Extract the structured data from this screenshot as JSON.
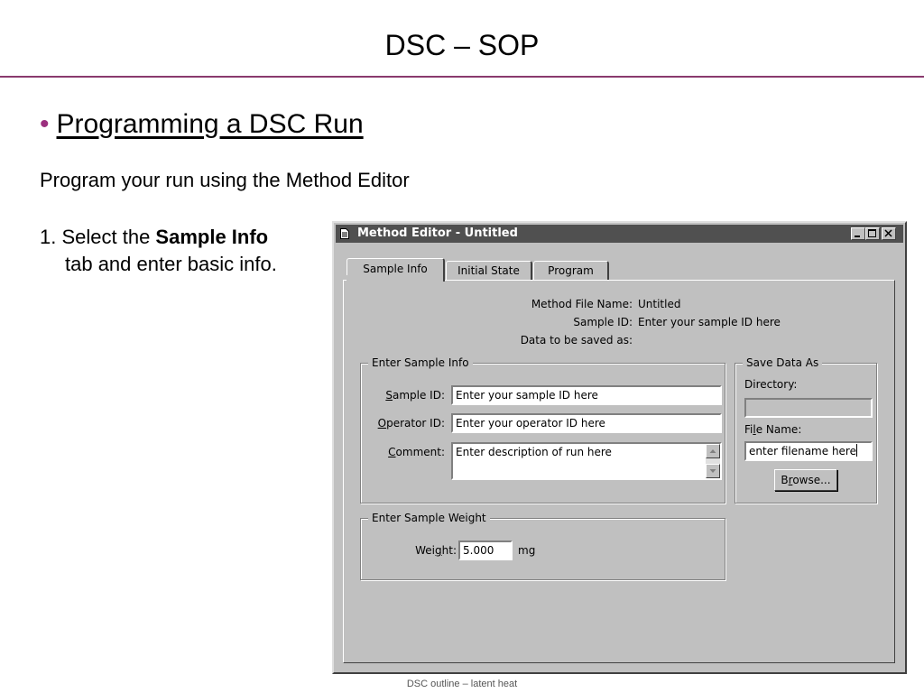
{
  "slide": {
    "title": "DSC – SOP",
    "heading_bullet": "•",
    "heading": "Programming a DSC Run",
    "intro": "Program your run using the Method Editor",
    "step_prefix": "1. Select the ",
    "step_bold": "Sample Info",
    "step_line2": "tab and enter basic info.",
    "footer": "DSC outline – latent heat",
    "colors": {
      "rule": "#8a3a6e",
      "bullet": "#9b2f7e"
    }
  },
  "window": {
    "title": "Method Editor - Untitled",
    "icon": "document-icon",
    "controls": [
      "minimize-icon",
      "maximize-icon",
      "close-icon"
    ],
    "tabs": [
      {
        "label": "Sample Info",
        "active": true
      },
      {
        "label": "Initial State",
        "active": false
      },
      {
        "label": "Program",
        "active": false
      }
    ],
    "summary": {
      "method_file_label": "Method File Name:",
      "method_file_value": "Untitled",
      "sample_id_label": "Sample ID:",
      "sample_id_value": "Enter your sample ID here",
      "data_saved_label": "Data to be saved as:"
    },
    "sample_info": {
      "group_title": "Enter Sample Info",
      "sample_id_label_hot": "S",
      "sample_id_label_rest": "ample ID:",
      "sample_id_value": "Enter your sample ID here",
      "operator_id_label_hot": "O",
      "operator_id_label_rest": "perator ID:",
      "operator_id_value": "Enter your operator ID here",
      "comment_label_hot": "C",
      "comment_label_rest": "omment:",
      "comment_value": "Enter description of run here"
    },
    "save_data": {
      "group_title": "Save Data As",
      "directory_label": "Directory:",
      "directory_value": "",
      "file_name_label_pre": "Fi",
      "file_name_label_hot": "l",
      "file_name_label_rest": "e Name:",
      "file_name_value": "enter filename here",
      "browse_pre": "B",
      "browse_hot": "r",
      "browse_rest": "owse..."
    },
    "weight": {
      "group_title": "Enter Sample Weight",
      "label_pre": "Wei",
      "label_hot": "g",
      "label_rest": "ht:",
      "value": "5.000",
      "unit": "mg"
    }
  }
}
